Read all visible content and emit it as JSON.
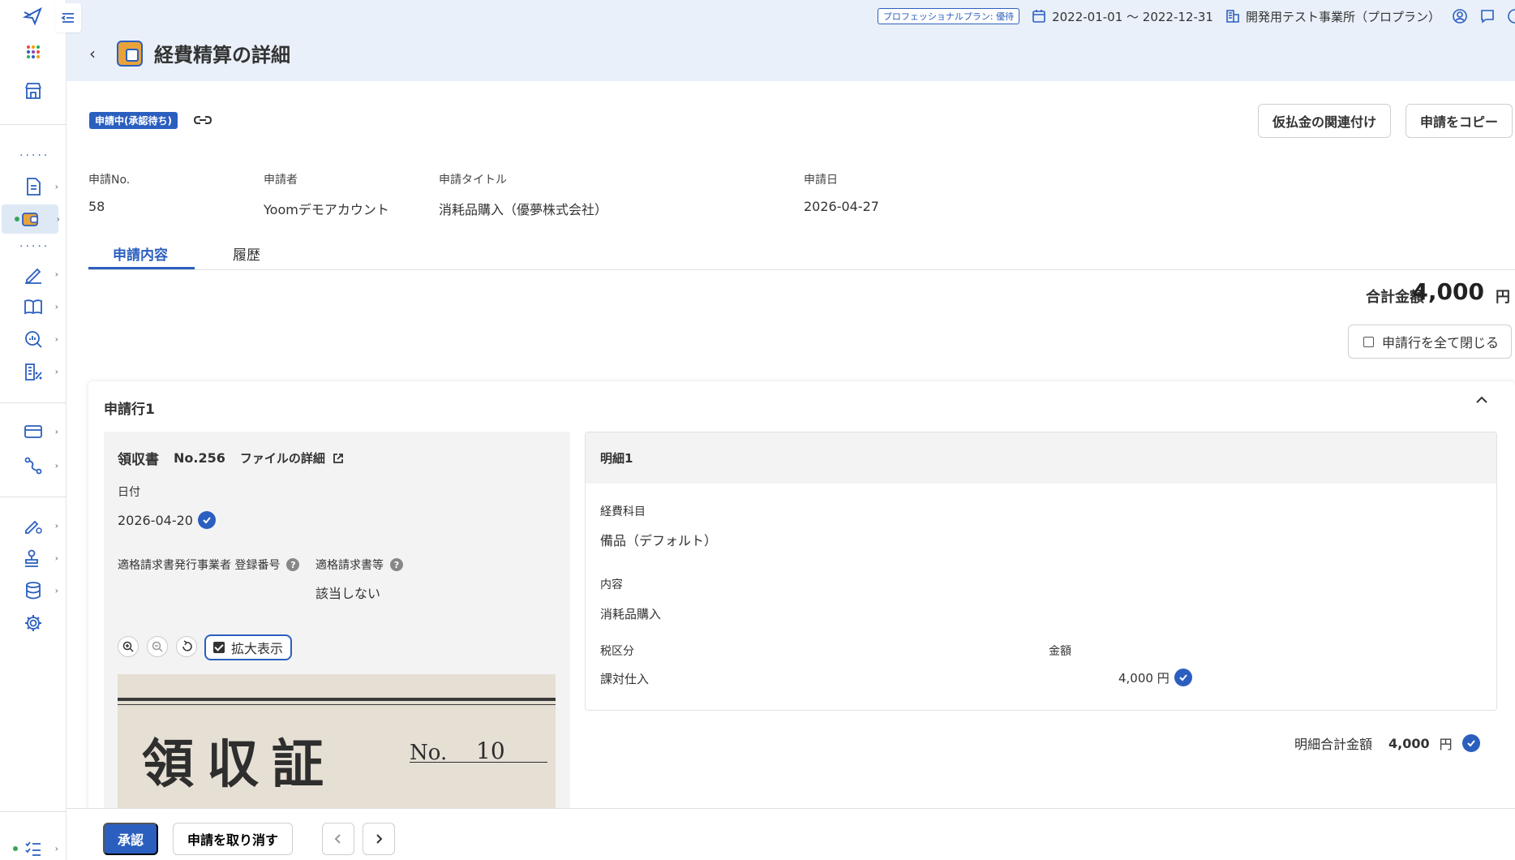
{
  "topbar": {
    "plan_badge": "プロフェッショナルプラン: 優待",
    "period": "2022-01-01 〜 2022-12-31",
    "office": "開発用テスト事業所（プロプラン）"
  },
  "page": {
    "title": "経費精算の詳細",
    "status": "申請中(承認待ち)",
    "actions": {
      "link_advance": "仮払金の関連付け",
      "copy_request": "申請をコピー"
    }
  },
  "meta": {
    "no_label": "申請No.",
    "no_value": "58",
    "applicant_label": "申請者",
    "applicant_value": "Yoomデモアカウント",
    "title_label": "申請タイトル",
    "title_value": "消耗品購入（優夢株式会社）",
    "date_label": "申請日",
    "date_value": "2026-04-27"
  },
  "tabs": [
    {
      "label": "申請内容",
      "active": true
    },
    {
      "label": "履歴",
      "active": false
    }
  ],
  "summary": {
    "total_label": "合計金額",
    "total_value": "4,000",
    "total_unit": "円",
    "close_all_label": "申請行を全て閉じる"
  },
  "line": {
    "title": "申請行1",
    "receipt": {
      "type": "領収書",
      "number": "No.256",
      "file_detail": "ファイルの詳細",
      "date_label": "日付",
      "date_value": "2026-04-20",
      "reg_label": "適格請求書発行事業者 登録番号",
      "qualified_label": "適格請求書等",
      "qualified_value": "該当しない",
      "expand_label": "拡大表示",
      "image": {
        "title": "領収証",
        "no_label": "No.",
        "no_value": "10"
      }
    },
    "detail": {
      "title": "明細1",
      "account_label": "経費科目",
      "account_value": "備品（デフォルト）",
      "content_label": "内容",
      "content_value": "消耗品購入",
      "tax_label": "税区分",
      "tax_value": "課対仕入",
      "amount_label": "金額",
      "amount_value": "4,000 円"
    },
    "detail_total_label": "明細合計金額",
    "detail_total_value": "4,000",
    "detail_total_unit": "円"
  },
  "bottom": {
    "approve": "承認",
    "cancel_request": "申請を取り消す"
  },
  "colors": {
    "accent": "#2b5fbf",
    "header_band": "#e9f0f9",
    "title_icon": "#e8a33a"
  }
}
